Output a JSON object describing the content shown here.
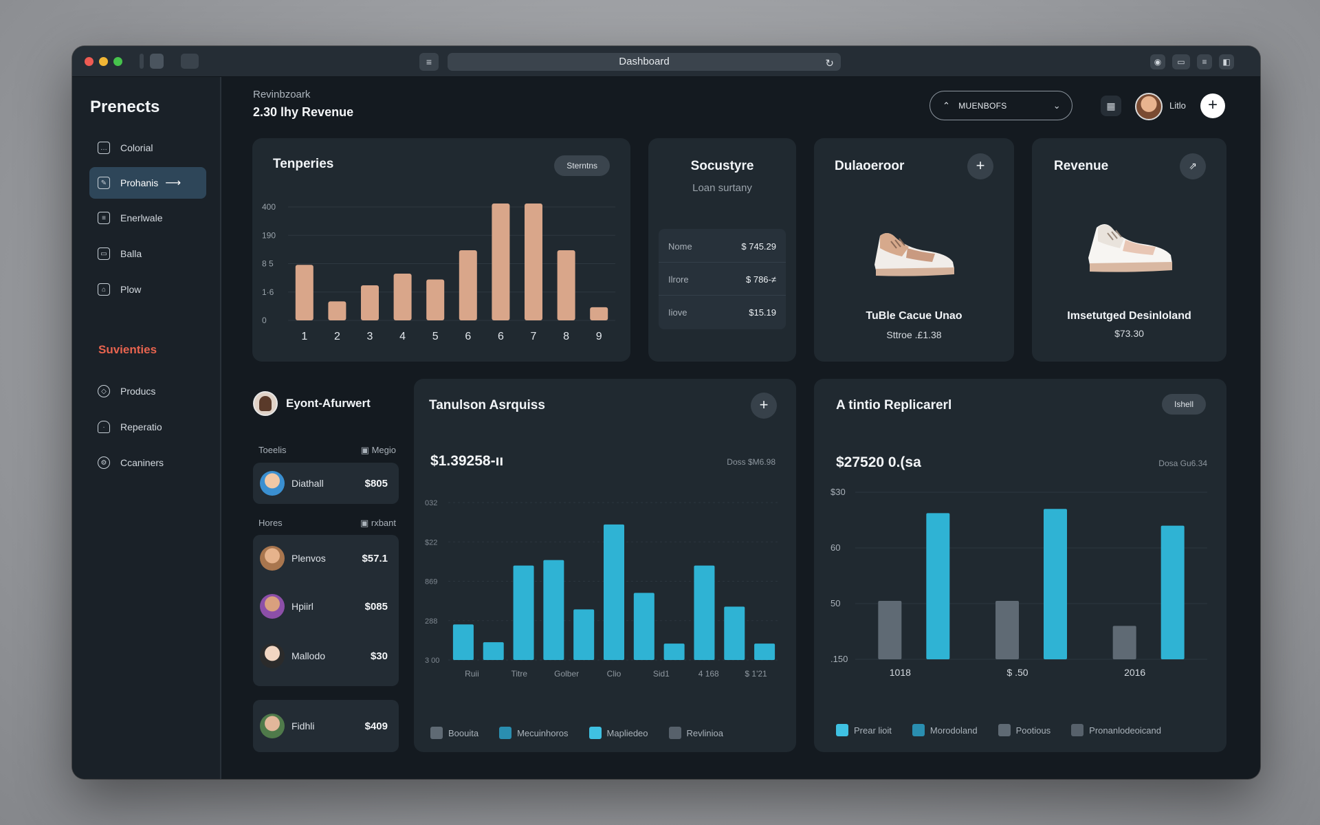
{
  "window": {
    "address": "Dashboard"
  },
  "sidebar": {
    "brand": "Prenects",
    "items": [
      {
        "label": "Colorial",
        "icon": "chat-icon"
      },
      {
        "label": "Prohanis",
        "icon": "edit-icon",
        "active": true
      },
      {
        "label": "Enerlwale",
        "icon": "document-icon"
      },
      {
        "label": "Balla",
        "icon": "folder-icon"
      },
      {
        "label": "Plow",
        "icon": "home-icon"
      }
    ],
    "section_title": "Suvienties",
    "section_items": [
      {
        "label": "Producs",
        "icon": "tag-icon"
      },
      {
        "label": "Reperatio",
        "icon": "bell-icon"
      },
      {
        "label": "Ccaniners",
        "icon": "settings-icon"
      }
    ]
  },
  "header": {
    "subtitle": "Revinbzoark",
    "title": "2.30 lhy Revenue",
    "select_value": "MUENBOFS",
    "user_name": "Litlo",
    "plus": "+"
  },
  "card_temperies": {
    "title": "Tenperies",
    "pill": "Sterntns",
    "chart_data": {
      "type": "bar",
      "categories": [
        "1",
        "2",
        "3",
        "4",
        "5",
        "6",
        "6",
        "7",
        "8",
        "9"
      ],
      "values": [
        190,
        65,
        120,
        160,
        140,
        240,
        400,
        400,
        240,
        45
      ],
      "ytick_labels": [
        "0",
        "1·6",
        "8 5",
        "190",
        "400"
      ],
      "ylim": [
        0,
        400
      ],
      "color": "#d9a68a"
    }
  },
  "card_summary": {
    "title": "Socustyre",
    "subtitle": "Loan surtany",
    "rows": [
      {
        "key": "Nome",
        "value": "$ 745.29"
      },
      {
        "key": "Ilrore",
        "value": "$  786-≠"
      },
      {
        "key": "Iiove",
        "value": "$15.19"
      }
    ]
  },
  "card_product_1": {
    "title": "Dulaoeroor",
    "name": "TuBle Cacue Unao",
    "price": "Sttroe .£1.38"
  },
  "card_product_2": {
    "title": "Revenue",
    "name": "Imsetutged Desinloland",
    "price": "$73.30"
  },
  "events": {
    "title": "Eyont-Afurwert",
    "section1": {
      "left": "Toeelis",
      "right": "Megio"
    },
    "section2": {
      "left": "Hores",
      "right": "rxbant"
    },
    "rows": [
      {
        "name": "Diathall",
        "value": "$805"
      },
      {
        "name": "Plenvos",
        "value": "$57.1"
      },
      {
        "name": "Hpiirl",
        "value": "$085"
      },
      {
        "name": "Mallodo",
        "value": "$30"
      },
      {
        "name": "Fidhli",
        "value": "$409"
      }
    ]
  },
  "card_transactions": {
    "title": "Tanulson Asrquiss",
    "amount": "$1.39258-ıı",
    "meta": "Doss $M6.98",
    "chart_data": {
      "type": "bar",
      "categories": [
        "Ruii",
        "Titre",
        "Golber",
        "Clio",
        "Sid1",
        "4 168",
        "$ 1'21"
      ],
      "values": [
        52,
        26,
        138,
        146,
        74,
        198,
        98,
        24,
        138,
        78,
        24
      ],
      "ytick_labels": [
        "3 00",
        "288",
        "869",
        "$22",
        "032"
      ],
      "ylim": [
        0,
        230
      ],
      "color": "#2fb3d4"
    },
    "legend": [
      {
        "label": "Boouita",
        "color": "#5f6a74"
      },
      {
        "label": "Mecuinhoros",
        "color": "#2a8eb0"
      },
      {
        "label": "Mapliedeo",
        "color": "#3fc1e2"
      },
      {
        "label": "Revlinioa",
        "color": "#57616b"
      }
    ]
  },
  "card_replicarel": {
    "title": "A tintio Replicarerl",
    "pill": "Ishell",
    "amount": "$27520 0.(sa",
    "meta": "Dosa Gu6.34",
    "chart_data": {
      "type": "bar",
      "categories": [
        "1018",
        "$ .50",
        "2016"
      ],
      "series": [
        {
          "name": "Prear lioit",
          "values": [
            70,
            70,
            40
          ]
        },
        {
          "name": "Morodoland",
          "values": [
            175,
            180,
            160
          ]
        }
      ],
      "ytick_labels": [
        ".150",
        "50",
        "60",
        "$30"
      ],
      "ylim": [
        0,
        200
      ],
      "colors": [
        "#5f6a74",
        "#2fb3d4"
      ]
    },
    "legend": [
      {
        "label": "Prear lioit",
        "color": "#3fc1e2"
      },
      {
        "label": "Morodoland",
        "color": "#2a8eb0"
      },
      {
        "label": "Pootious",
        "color": "#5f6a74"
      },
      {
        "label": "Pronanlodeoicand",
        "color": "#57616b"
      }
    ]
  }
}
